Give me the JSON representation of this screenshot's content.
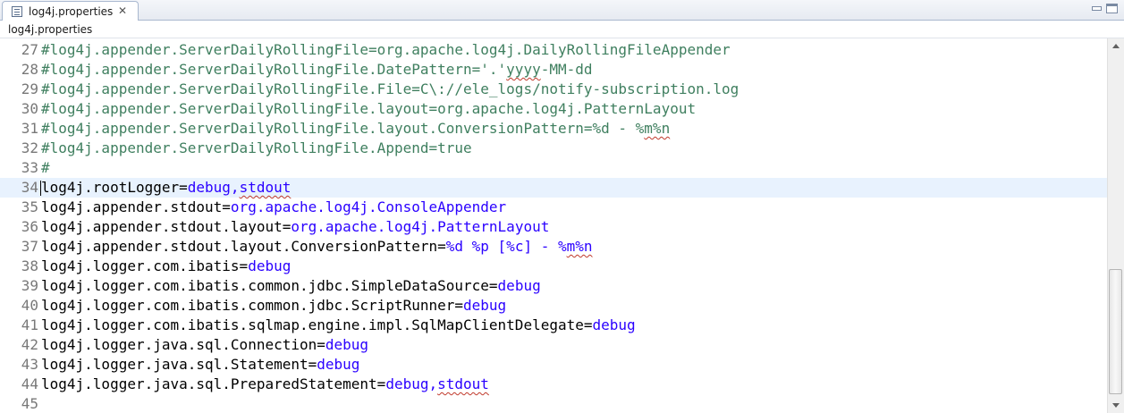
{
  "tab": {
    "title": "log4j.properties",
    "close_glyph": "✕",
    "icon": "properties-file-icon"
  },
  "window_controls": {
    "minimize": "minimize-icon",
    "maximize": "maximize-icon"
  },
  "breadcrumb": {
    "label": "log4j.properties"
  },
  "editor": {
    "current_line": 34,
    "colors": {
      "key": "#000000",
      "value": "#2a00ff",
      "comment": "#3f7f5f",
      "line_number": "#787878",
      "current_line_bg": "#e8f2fe"
    },
    "lines": [
      {
        "n": "27",
        "segments": [
          {
            "t": "#log4j.appender.ServerDailyRollingFile=org.apache.log4j.DailyRollingFileAppender",
            "c": "c"
          }
        ]
      },
      {
        "n": "28",
        "segments": [
          {
            "t": "#log4j.appender.ServerDailyRollingFile.DatePattern='.'",
            "c": "c"
          },
          {
            "t": "yyyy",
            "c": "c",
            "sq": true
          },
          {
            "t": "-MM-dd",
            "c": "c"
          }
        ]
      },
      {
        "n": "29",
        "segments": [
          {
            "t": "#log4j.appender.ServerDailyRollingFile.File=C\\://ele_logs/notify-subscription.log",
            "c": "c"
          }
        ]
      },
      {
        "n": "30",
        "segments": [
          {
            "t": "#log4j.appender.ServerDailyRollingFile.layout=org.apache.log4j.PatternLayout",
            "c": "c"
          }
        ]
      },
      {
        "n": "31",
        "segments": [
          {
            "t": "#log4j.appender.ServerDailyRollingFile.layout.ConversionPattern=%d - %",
            "c": "c"
          },
          {
            "t": "m%n",
            "c": "c",
            "sq": true
          }
        ]
      },
      {
        "n": "32",
        "segments": [
          {
            "t": "#log4j.appender.ServerDailyRollingFile.Append=true",
            "c": "c"
          }
        ]
      },
      {
        "n": "33",
        "segments": [
          {
            "t": "#",
            "c": "c"
          }
        ]
      },
      {
        "n": "34",
        "segments": [
          {
            "t": "log4j.rootLogger=",
            "c": "k"
          },
          {
            "t": "debug,",
            "c": "v"
          },
          {
            "t": "stdout",
            "c": "v",
            "sq": true
          }
        ]
      },
      {
        "n": "35",
        "segments": [
          {
            "t": "log4j.appender.stdout=",
            "c": "k"
          },
          {
            "t": "org.apache.log4j.ConsoleAppender",
            "c": "v"
          }
        ]
      },
      {
        "n": "36",
        "segments": [
          {
            "t": "log4j.appender.stdout.layout=",
            "c": "k"
          },
          {
            "t": "org.apache.log4j.PatternLayout",
            "c": "v"
          }
        ]
      },
      {
        "n": "37",
        "segments": [
          {
            "t": "log4j.appender.stdout.layout.ConversionPattern=",
            "c": "k"
          },
          {
            "t": "%d %p [%c] - %",
            "c": "v"
          },
          {
            "t": "m%n",
            "c": "v",
            "sq": true
          }
        ]
      },
      {
        "n": "38",
        "segments": [
          {
            "t": "log4j.logger.com.ibatis=",
            "c": "k"
          },
          {
            "t": "debug",
            "c": "v"
          }
        ]
      },
      {
        "n": "39",
        "segments": [
          {
            "t": "log4j.logger.com.ibatis.common.jdbc.SimpleDataSource=",
            "c": "k"
          },
          {
            "t": "debug",
            "c": "v"
          }
        ]
      },
      {
        "n": "40",
        "segments": [
          {
            "t": "log4j.logger.com.ibatis.common.jdbc.ScriptRunner=",
            "c": "k"
          },
          {
            "t": "debug",
            "c": "v"
          }
        ]
      },
      {
        "n": "41",
        "segments": [
          {
            "t": "log4j.logger.com.ibatis.sqlmap.engine.impl.SqlMapClientDelegate=",
            "c": "k"
          },
          {
            "t": "debug",
            "c": "v"
          }
        ]
      },
      {
        "n": "42",
        "segments": [
          {
            "t": "log4j.logger.java.sql.Connection=",
            "c": "k"
          },
          {
            "t": "debug",
            "c": "v"
          }
        ]
      },
      {
        "n": "43",
        "segments": [
          {
            "t": "log4j.logger.java.sql.Statement=",
            "c": "k"
          },
          {
            "t": "debug",
            "c": "v"
          }
        ]
      },
      {
        "n": "44",
        "segments": [
          {
            "t": "log4j.logger.java.sql.PreparedStatement=",
            "c": "k"
          },
          {
            "t": "debug,",
            "c": "v"
          },
          {
            "t": "stdout",
            "c": "v",
            "sq": true
          }
        ]
      },
      {
        "n": "45",
        "segments": []
      }
    ]
  },
  "scrollbar": {
    "up_icon": "scroll-up-arrow-icon",
    "down_icon": "scroll-down-arrow-icon"
  }
}
